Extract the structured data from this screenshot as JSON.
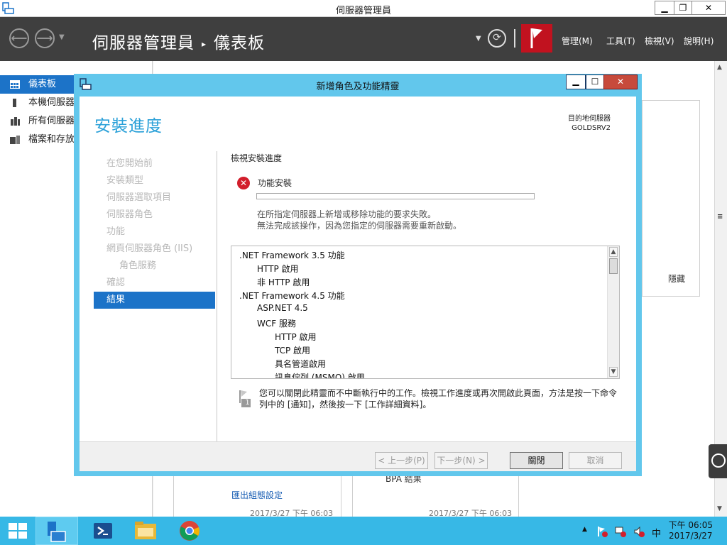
{
  "server_manager": {
    "window_title": "伺服器管理員",
    "breadcrumb_root": "伺服器管理員",
    "breadcrumb_current": "儀表板",
    "menus": [
      "管理(M)",
      "工具(T)",
      "檢視(V)",
      "說明(H)"
    ],
    "sidebar": [
      "儀表板",
      "本機伺服器",
      "所有伺服器",
      "檔案和存放"
    ],
    "hide_label": "隱藏",
    "bpa_label": "BPA 結果",
    "timestamps": [
      "2017/3/27 下午 06:03",
      "2017/3/27 下午 06:03"
    ]
  },
  "wizard": {
    "title": "新增角色及功能精靈",
    "heading": "安裝進度",
    "destination_label": "目的地伺服器",
    "destination_server": "GOLDSRV2",
    "steps": [
      "在您開始前",
      "安裝類型",
      "伺服器選取項目",
      "伺服器角色",
      "功能",
      "網頁伺服器角色 (IIS)",
      "角色服務",
      "確認",
      "結果"
    ],
    "progress_label": "檢視安裝進度",
    "feature_install": "功能安裝",
    "progress_percent": 0,
    "error_lines": [
      "在所指定伺服器上新增或移除功能的要求失敗。",
      "無法完成該操作，因為您指定的伺服器需要重新啟動。"
    ],
    "results": [
      {
        "text": ".NET Framework 3.5 功能",
        "level": 0
      },
      {
        "text": "HTTP 啟用",
        "level": 1
      },
      {
        "text": "非 HTTP 啟用",
        "level": 1
      },
      {
        "text": ".NET Framework 4.5 功能",
        "level": 0
      },
      {
        "text": "ASP.NET 4.5",
        "level": 1
      },
      {
        "text": "WCF 服務",
        "level": 1
      },
      {
        "text": "HTTP 啟用",
        "level": 2
      },
      {
        "text": "TCP 啟用",
        "level": 2
      },
      {
        "text": "具名管道啟用",
        "level": 2
      },
      {
        "text": "訊息佇列 (MSMQ) 啟用",
        "level": 2
      }
    ],
    "notice": "您可以關閉此精靈而不中斷執行中的工作。檢視工作進度或再次開啟此頁面，方法是按一下命令列中的 [通知]，然後按一下 [工作詳細資料]。",
    "notification_count": "1",
    "export_link": "匯出組態設定",
    "buttons": {
      "prev": "< 上一步(P)",
      "next": "下一步(N) >",
      "close": "關閉",
      "cancel": "取消"
    }
  },
  "taskbar": {
    "ime": "中",
    "time": "下午 06:05",
    "date": "2017/3/27"
  },
  "colors": {
    "accent": "#1c73c8",
    "wizard_frame": "#62c7ec",
    "taskbar": "#37b8e6",
    "heading": "#2aa0d8",
    "error": "#d21e2b",
    "header": "#3f3f3f"
  }
}
